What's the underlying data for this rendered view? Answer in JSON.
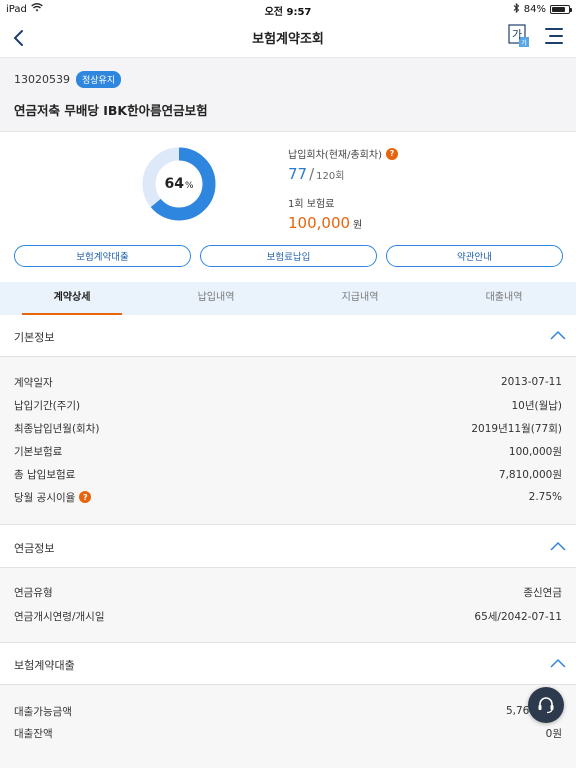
{
  "status_bar": {
    "device": "iPad",
    "time": "오전 9:57",
    "battery": "84%",
    "battery_level": 0.84
  },
  "nav": {
    "title": "보험계약조회",
    "font_button": "가"
  },
  "contract": {
    "number": "13020539",
    "status": "정상유지",
    "product_name": "연금저축 무배당 IBK한아름연금보험"
  },
  "summary": {
    "progress_percent": 64,
    "progress_text": "64",
    "percent_sign": "%",
    "payment_label": "납입회차(현재/총회차)",
    "current_count": "77",
    "slash": "/",
    "total_count": "120회",
    "premium_label": "1회 보험료",
    "premium_value": "100,000",
    "premium_unit": "원",
    "accent_color": "#2f86de",
    "track_color": "#dde9f8"
  },
  "actions": {
    "loan": "보험계약대출",
    "pay": "보험료납입",
    "terms": "약관안내"
  },
  "tabs": [
    "계약상세",
    "납입내역",
    "지급내역",
    "대출내역"
  ],
  "sections": {
    "basic": {
      "title": "기본정보",
      "rows": [
        {
          "label": "계약일자",
          "value": "2013-07-11"
        },
        {
          "label": "납입기간(주기)",
          "value": "10년(월납)"
        },
        {
          "label": "최종납입년월(회차)",
          "value": "2019년11월(77회)"
        },
        {
          "label": "기본보험료",
          "value": "100,000원"
        },
        {
          "label": "총 납입보험료",
          "value": "7,810,000원"
        },
        {
          "label": "당월 공시이율",
          "value": "2.75%"
        }
      ]
    },
    "annuity": {
      "title": "연금정보",
      "rows": [
        {
          "label": "연금유형",
          "value": "종신연금"
        },
        {
          "label": "연금개시연령/개시일",
          "value": "65세/2042-07-11"
        }
      ]
    },
    "loan": {
      "title": "보험계약대출",
      "rows": [
        {
          "label": "대출가능금액",
          "value": "5,760"
        },
        {
          "label": "대출잔액",
          "value": "0원"
        }
      ]
    }
  },
  "help_mark": "?"
}
